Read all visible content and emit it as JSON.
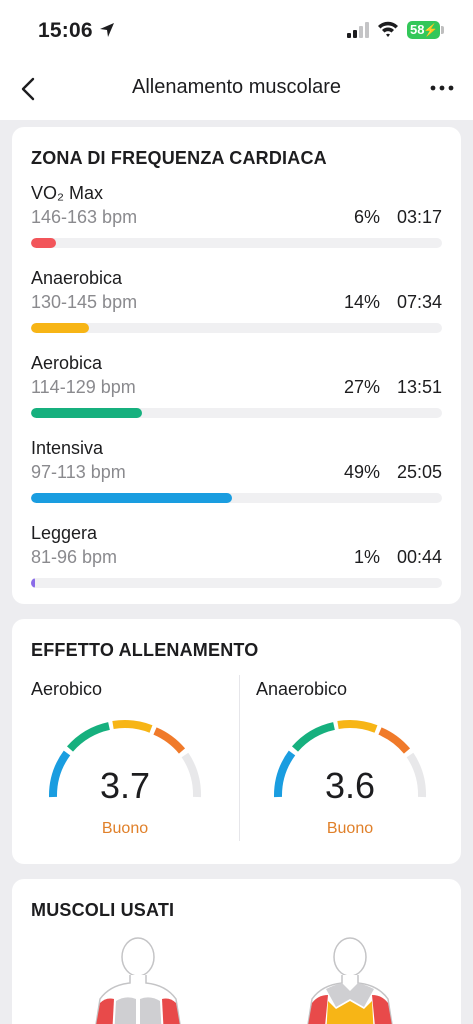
{
  "status_bar": {
    "time": "15:06",
    "battery": "58"
  },
  "nav": {
    "title": "Allenamento muscolare"
  },
  "hr_zones": {
    "title": "ZONA DI FREQUENZA CARDIACA",
    "zones": [
      {
        "name": "VO₂ Max",
        "range": "146-163 bpm",
        "percent": "6%",
        "time": "03:17",
        "fill_fraction": 0.06,
        "color": "#f2555a"
      },
      {
        "name": "Anaerobica",
        "range": "130-145 bpm",
        "percent": "14%",
        "time": "07:34",
        "fill_fraction": 0.14,
        "color": "#f7b516"
      },
      {
        "name": "Aerobica",
        "range": "114-129 bpm",
        "percent": "27%",
        "time": "13:51",
        "fill_fraction": 0.27,
        "color": "#16b07e"
      },
      {
        "name": "Intensiva",
        "range": "97-113 bpm",
        "percent": "49%",
        "time": "25:05",
        "fill_fraction": 0.49,
        "color": "#1a9de0"
      },
      {
        "name": "Leggera",
        "range": "81-96 bpm",
        "percent": "1%",
        "time": "00:44",
        "fill_fraction": 0.01,
        "color": "#8a6be8"
      }
    ]
  },
  "training_effect": {
    "title": "EFFETTO ALLENAMENTO",
    "aerobic": {
      "label": "Aerobico",
      "value": "3.7",
      "rating": "Buono"
    },
    "anaerobic": {
      "label": "Anaerobico",
      "value": "3.6",
      "rating": "Buono"
    }
  },
  "muscles": {
    "title": "MUSCOLI USATI"
  },
  "colors": {
    "accent_orange": "#e0802a",
    "gauge_blue": "#1a9de0",
    "gauge_green": "#16b07e",
    "gauge_yellow": "#f7b516",
    "gauge_orange": "#f07a2a",
    "gauge_track": "#e8e8ea"
  }
}
